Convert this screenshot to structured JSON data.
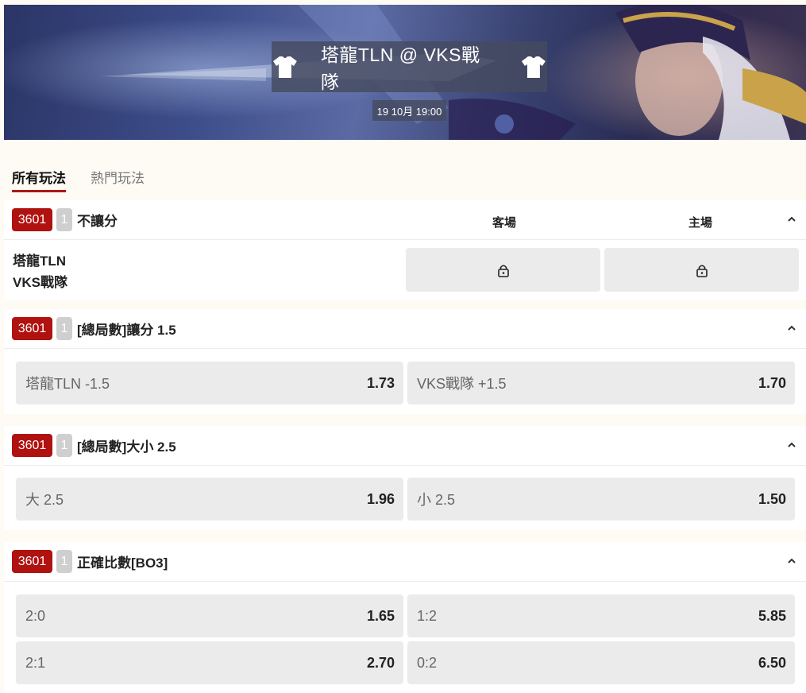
{
  "banner": {
    "title": "塔龍TLN @ VKS戰隊",
    "datetime": "19 10月 19:00",
    "left_icon": "jersey-icon",
    "right_icon": "jersey-icon"
  },
  "tabs": [
    {
      "label": "所有玩法",
      "active": true
    },
    {
      "label": "熱門玩法",
      "active": false
    }
  ],
  "markets": [
    {
      "code": "3601",
      "num": "1",
      "title": "不讓分",
      "col_away": "客場",
      "col_home": "主場",
      "teams": [
        "塔龍TLN",
        "VKS戰隊"
      ],
      "locked": true
    },
    {
      "code": "3601",
      "num": "1",
      "title": "[總局數]讓分 1.5",
      "odds": [
        {
          "label": "塔龍TLN -1.5",
          "value": "1.73"
        },
        {
          "label": "VKS戰隊 +1.5",
          "value": "1.70"
        }
      ]
    },
    {
      "code": "3601",
      "num": "1",
      "title": "[總局數]大小 2.5",
      "odds": [
        {
          "label": "大 2.5",
          "value": "1.96"
        },
        {
          "label": "小 2.5",
          "value": "1.50"
        }
      ]
    },
    {
      "code": "3601",
      "num": "1",
      "title": "正確比數[BO3]",
      "odds": [
        {
          "label": "2:0",
          "value": "1.65"
        },
        {
          "label": "1:2",
          "value": "5.85"
        },
        {
          "label": "2:1",
          "value": "2.70"
        },
        {
          "label": "0:2",
          "value": "6.50"
        }
      ]
    }
  ],
  "colors": {
    "accent_red": "#b0120f",
    "badge_gray": "#cfcfcf",
    "odds_bg": "#ebebeb",
    "page_bg": "#fdfbf3"
  }
}
